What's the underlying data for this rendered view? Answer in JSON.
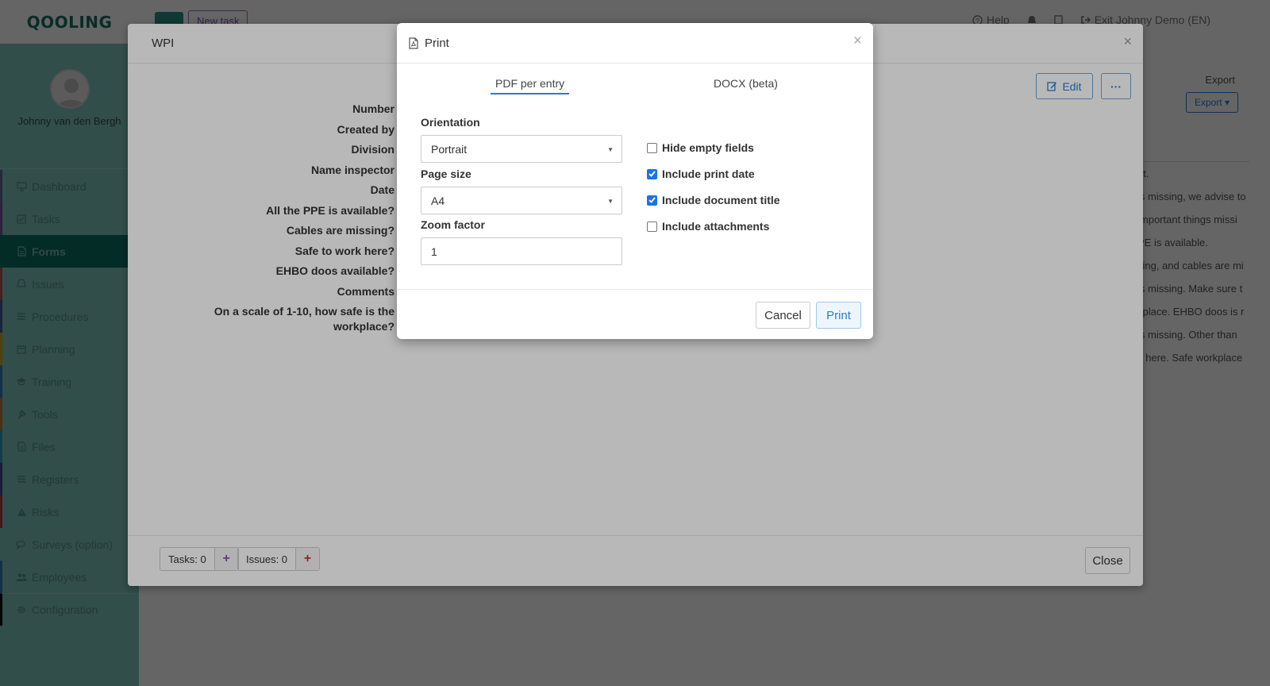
{
  "app": {
    "logo": "QOOLING",
    "user_name": "Johnny van den Bergh",
    "topbar": {
      "new_task": "New task",
      "help": "Help",
      "exit": "Exit Johnny Demo (EN)"
    },
    "nav": [
      {
        "label": "Dashboard",
        "icon": "monitor-icon",
        "color": "#5b6b9a"
      },
      {
        "label": "Tasks",
        "icon": "check-square-icon",
        "color": "#7a4fa0"
      },
      {
        "label": "Forms",
        "icon": "file-icon",
        "color": "#0b6f65",
        "active": true
      },
      {
        "label": "Issues",
        "icon": "bell-icon",
        "color": "#c0504d"
      },
      {
        "label": "Procedures",
        "icon": "list-icon",
        "color": "#3d5a99"
      },
      {
        "label": "Planning",
        "icon": "calendar-icon",
        "color": "#d6a21e"
      },
      {
        "label": "Training",
        "icon": "graduation-cap-icon",
        "color": "#2e7cb8"
      },
      {
        "label": "Tools",
        "icon": "wrench-icon",
        "color": "#c07a3a"
      },
      {
        "label": "Files",
        "icon": "file-icon",
        "color": "#2e9fb5"
      },
      {
        "label": "Registers",
        "icon": "list-icon",
        "color": "#3d4d99"
      },
      {
        "label": "Risks",
        "icon": "warning-icon",
        "color": "#b83a3a"
      },
      {
        "label": "Surveys (option)",
        "icon": "comments-icon",
        "color": "#7fc7bc"
      },
      {
        "label": "Employees",
        "icon": "users-icon",
        "color": "#2e7cb8"
      },
      {
        "label": "Configuration",
        "icon": "gear-icon",
        "color": "#111111"
      }
    ],
    "right_panel": {
      "export_label": "Export",
      "export_button": "Export",
      "search_placeholder": "h",
      "rows": [
        "nt.",
        "is missing, we advise to",
        "important things missi",
        "PE is available.",
        "sing, and cables are mi",
        "is missing. Make sure t",
        "kplace. EHBO doos is r",
        "is missing. Other than",
        "s here. Safe workplace"
      ]
    }
  },
  "wpi_modal": {
    "title": "WPI",
    "edit": "Edit",
    "more": "···",
    "fields": [
      "Number",
      "Created by",
      "Division",
      "Name inspector",
      "Date",
      "All the PPE is available?",
      "Cables are missing?",
      "Safe to work here?",
      "EHBO doos available?",
      "Comments",
      "On a scale of 1-10, how safe is the workplace?"
    ],
    "tasks_count": "Tasks: 0",
    "issues_count": "Issues: 0",
    "close": "Close"
  },
  "print_modal": {
    "title": "Print",
    "tabs": [
      {
        "label": "PDF per entry",
        "active": true
      },
      {
        "label": "DOCX (beta)",
        "active": false
      }
    ],
    "orientation": {
      "label": "Orientation",
      "value": "Portrait"
    },
    "page_size": {
      "label": "Page size",
      "value": "A4"
    },
    "zoom": {
      "label": "Zoom factor",
      "value": "1"
    },
    "options": [
      {
        "label": "Hide empty fields",
        "checked": false
      },
      {
        "label": "Include print date",
        "checked": true
      },
      {
        "label": "Include document title",
        "checked": true
      },
      {
        "label": "Include attachments",
        "checked": false
      }
    ],
    "cancel": "Cancel",
    "print": "Print"
  }
}
